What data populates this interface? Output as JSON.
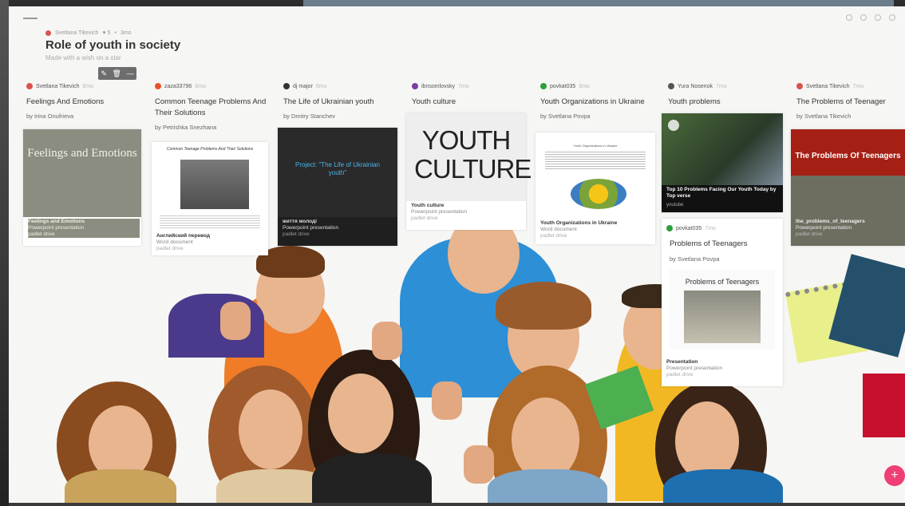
{
  "board": {
    "breadcrumb_author": "Svetlana Tikevich",
    "breadcrumb_count": "♥ 5",
    "breadcrumb_time": "3mo",
    "title": "Role of youth in society",
    "subtitle": "Made with a wish on a star"
  },
  "edit_bar": {
    "icons": [
      "pencil-icon",
      "trash-icon",
      "more-icon"
    ]
  },
  "columns": [
    {
      "author": "Svetlana Tikevich",
      "time": "6mo",
      "title": "Feelings And Emotions",
      "by": "by Irina Onufrieva",
      "avatar_color": "#d9534f",
      "card": {
        "image_text": "Feelings and Emotions",
        "name": "Feelings and Emotions",
        "type": "Powerpoint presentation",
        "source": "padlet drive"
      }
    },
    {
      "author": "zaza33796",
      "time": "6mo",
      "title": "Common Teenage Problems And Their Solutions",
      "by": "by Petrishka Snezhana",
      "avatar_color": "#e8542c",
      "card": {
        "image_text": "Common Teenage Problems And Their Solutions",
        "name": "Английский перевод",
        "type": "Word document",
        "source": "padlet drive"
      }
    },
    {
      "author": "dj major",
      "time": "6mo",
      "title": "The Life of Ukrainian youth",
      "by": "by Dmitry Stanchev",
      "avatar_color": "#333333",
      "card": {
        "image_text": "Project: \"The Life of Ukrainian youth\"",
        "name": "життя молоді",
        "type": "Powerpoint presentation",
        "source": "padlet drive"
      }
    },
    {
      "author": "ibnsomlovsky",
      "time": "7mo",
      "title": "Youth culture",
      "by": "",
      "avatar_color": "#7a3fa0",
      "card": {
        "image_text": "YOUTH CULTURE",
        "name": "Youth culture",
        "type": "Powerpoint presentation",
        "source": "padlet drive"
      }
    },
    {
      "author": "povkat035",
      "time": "6mo",
      "title": "Youth Organizations in Ukraine",
      "by": "by Svetlana Povpa",
      "avatar_color": "#2e9e3e",
      "card": {
        "image_text": "Youth Organizations in Ukraine",
        "name": "Youth Organizations in Ukraine",
        "type": "Word document",
        "source": "padlet drive"
      }
    },
    {
      "author": "Yura Nosenok",
      "time": "7mo",
      "title": "Youth problems",
      "by": "",
      "avatar_color": "#555555",
      "card": {
        "image_text": "Top 10 Problems Facing Our Youth Today by Top verse",
        "name": "",
        "type": "",
        "source": "youtube"
      }
    },
    {
      "author": "Svetlana Tikevich",
      "time": "7mo",
      "title": "The Problems of Teenager",
      "by": "by Svetlana Tikevich",
      "avatar_color": "#d9534f",
      "card": {
        "image_text": "The Problems Of Teenagers",
        "name": "the_problems_of_teenagers",
        "type": "Powerpoint presentation",
        "source": "padlet drive"
      }
    }
  ],
  "extra_post": {
    "author": "povkat035",
    "time": "7mo",
    "title": "Problems of Teenagers",
    "by": "by Svetlana Povpa",
    "avatar_color": "#2e9e3e",
    "card": {
      "image_text": "Problems of Teenagers",
      "name": "Presentation",
      "type": "Powerpoint presentation",
      "source": "padlet drive"
    }
  },
  "fab_label": "+"
}
